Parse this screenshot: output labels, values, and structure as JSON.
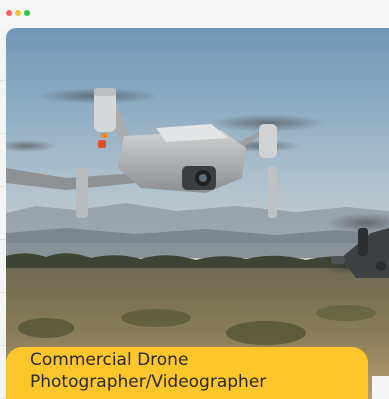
{
  "window": {
    "dots": [
      {
        "name": "close-dot",
        "color": "#ff5f57"
      },
      {
        "name": "minimize-dot",
        "color": "#febc2e"
      },
      {
        "name": "zoom-dot",
        "color": "#28c840"
      }
    ]
  },
  "card": {
    "caption_line1": "Commercial Drone",
    "caption_line2": "Photographer/Videographer",
    "accent_color": "#fdc62a"
  }
}
